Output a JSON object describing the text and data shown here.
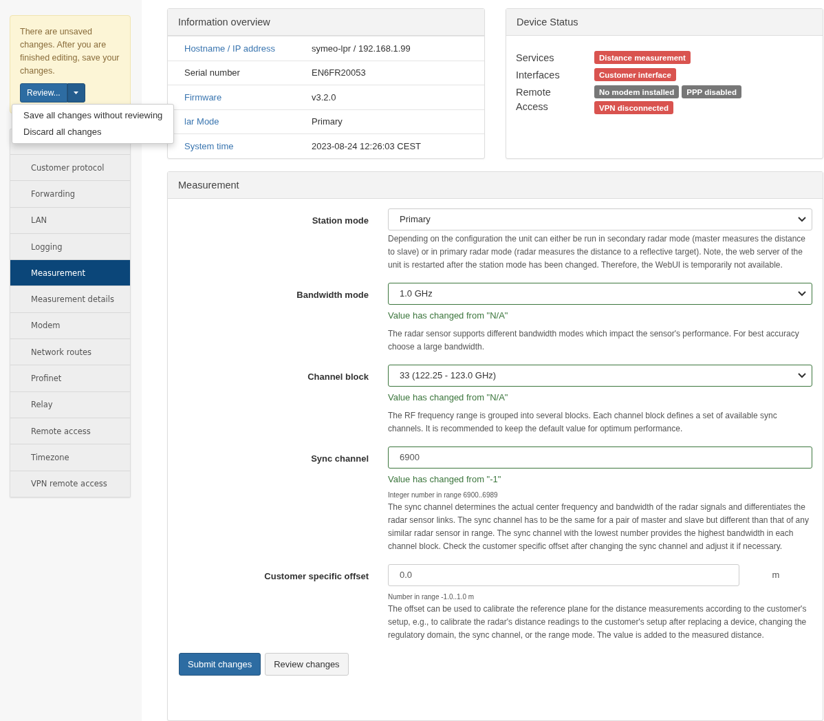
{
  "unsaved_notice": {
    "message": "There are unsaved changes. After you are finished editing, save your changes.",
    "review_button": "Review...",
    "menu": [
      {
        "label": "Save all changes without reviewing"
      },
      {
        "label": "Discard all changes"
      }
    ]
  },
  "sidebar": {
    "items": [
      {
        "label": "Customer protocol",
        "selected": false
      },
      {
        "label": "Forwarding",
        "selected": false
      },
      {
        "label": "LAN",
        "selected": false
      },
      {
        "label": "Logging",
        "selected": false
      },
      {
        "label": "Measurement",
        "selected": true
      },
      {
        "label": "Measurement details",
        "selected": false
      },
      {
        "label": "Modem",
        "selected": false
      },
      {
        "label": "Network routes",
        "selected": false
      },
      {
        "label": "Profinet",
        "selected": false
      },
      {
        "label": "Relay",
        "selected": false
      },
      {
        "label": "Remote access",
        "selected": false
      },
      {
        "label": "Timezone",
        "selected": false
      },
      {
        "label": "VPN remote access",
        "selected": false
      }
    ]
  },
  "information_overview": {
    "title": "Information overview",
    "rows": [
      {
        "label": "Hostname / IP address",
        "link": true,
        "value": "symeo-lpr / 192.168.1.99"
      },
      {
        "label": "Serial number",
        "link": false,
        "value": "EN6FR20053"
      },
      {
        "label": "Firmware",
        "link": true,
        "value": "v3.2.0"
      },
      {
        "label": "lar Mode",
        "link": true,
        "value": "Primary"
      },
      {
        "label": "System time",
        "link": true,
        "value": "2023-08-24 12:26:03 CEST"
      }
    ]
  },
  "device_status": {
    "title": "Device Status",
    "rows": [
      {
        "label": "Services",
        "badges": [
          {
            "text": "Distance measurement",
            "color": "#d9534f"
          }
        ]
      },
      {
        "label": "Interfaces",
        "badges": [
          {
            "text": "Customer interface",
            "color": "#d9534f"
          }
        ]
      },
      {
        "label": "Remote Access",
        "badges": [
          {
            "text": "No modem installed",
            "color": "#777777"
          },
          {
            "text": "PPP disabled",
            "color": "#777777"
          },
          {
            "text": "VPN disconnected",
            "color": "#d9534f"
          }
        ]
      }
    ]
  },
  "measurement": {
    "title": "Measurement",
    "fields": [
      {
        "label": "Station mode",
        "kind": "select",
        "value": "Primary",
        "changed": false,
        "help": "Depending on the configuration the unit can either be run in secondary radar mode (master measures the distance to slave) or in primary radar mode (radar measures the distance to a reflective target). Note, the web server of the unit is restarted after the station mode has been changed. Therefore, the WebUI is temporarily not available."
      },
      {
        "label": "Bandwidth mode",
        "kind": "select",
        "value": "1.0 GHz",
        "changed": true,
        "change_note": "Value has changed from \"N/A\"",
        "help": "The radar sensor supports different bandwidth modes which impact the sensor's performance. For best accuracy choose a large bandwidth."
      },
      {
        "label": "Channel block",
        "kind": "select",
        "value": "33 (122.25 - 123.0 GHz)",
        "changed": true,
        "change_note": "Value has changed from \"N/A\"",
        "help": "The RF frequency range is grouped into several blocks. Each channel block defines a set of available sync channels. It is recommended to keep the default value for optimum performance."
      },
      {
        "label": "Sync channel",
        "kind": "input",
        "value": "6900",
        "changed": true,
        "change_note": "Value has changed from \"-1\"",
        "range": "Integer number in range 6900..6989",
        "help": "The sync channel determines the actual center frequency and bandwidth of the radar signals and differentiates the radar sensor links. The sync channel has to be the same for a pair of master and slave but different than that of any similar radar sensor in range. The sync channel with the lowest number provides the highest bandwidth in each channel block. Check the customer specific offset after changing the sync channel and adjust it if necessary."
      },
      {
        "label": "Customer specific offset",
        "kind": "input",
        "value": "0.0",
        "unit": "m",
        "changed": false,
        "range": "Number in range -1.0..1.0 m",
        "help": "The offset can be used to calibrate the reference plane for the distance measurements according to the customer's setup, e.g., to calibrate the radar's distance readings to the customer's setup after replacing a device, changing the regulatory domain, the sync channel, or the range mode. The value is added to the measured distance."
      }
    ],
    "buttons": [
      {
        "label": "Submit changes",
        "kind": "primary"
      },
      {
        "label": "Review changes",
        "kind": "default"
      }
    ]
  }
}
